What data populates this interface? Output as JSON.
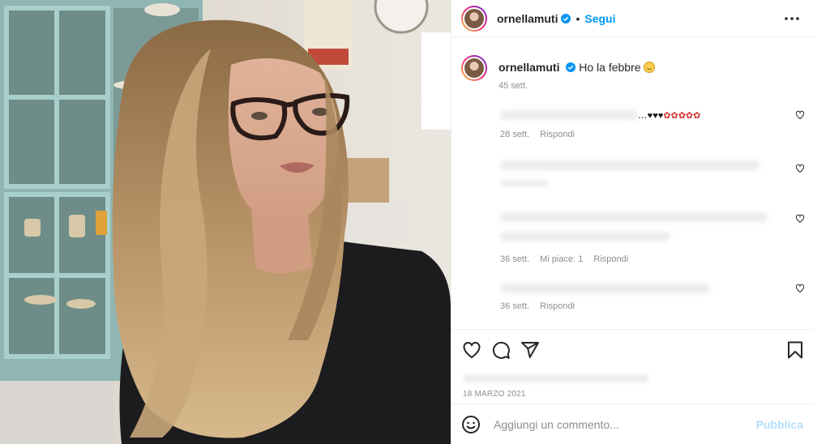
{
  "post": {
    "photo": {
      "alt": ""
    },
    "header": {
      "username": "ornellamuti",
      "separator": "•",
      "follow_label": "Segui",
      "more_icon": "more-horizontal-icon",
      "verified_icon": "verified-badge-icon",
      "verified_color": "#0095f6"
    },
    "caption": {
      "username": "ornellamuti",
      "text": "Ho la febbre",
      "time": "45 sett."
    },
    "comments": [
      {
        "text": "...",
        "time": "28 sett.",
        "reply_label": "Rispondi",
        "likes_label": ""
      },
      {
        "text": "",
        "time": "",
        "reply_label": "",
        "likes_label": ""
      },
      {
        "text": "",
        "time": "36 sett.",
        "likes_label": "Mi piace: 1",
        "reply_label": "Rispondi"
      },
      {
        "text": "",
        "time": "36 sett.",
        "reply_label": "Rispondi",
        "likes_label": ""
      }
    ],
    "actions": {
      "like_icon": "heart-icon",
      "comment_icon": "comment-icon",
      "share_icon": "share-icon",
      "save_icon": "bookmark-icon"
    },
    "date": "18 MARZO 2021",
    "add_comment": {
      "emoji_icon": "smiley-icon",
      "placeholder": "Aggiungi un commento...",
      "publish_label": "Pubblica"
    },
    "colors": {
      "link": "#0095f6",
      "publish_disabled": "#b2dffc",
      "secondary_text": "#8e8e8e",
      "border": "#efefef"
    }
  }
}
